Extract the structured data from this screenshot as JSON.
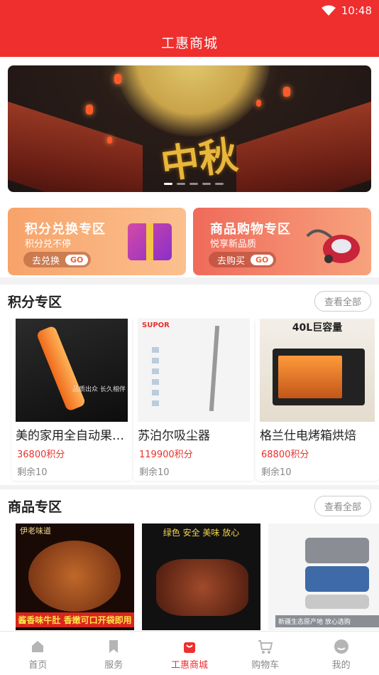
{
  "status_bar": {
    "time": "10:48"
  },
  "header": {
    "title": "工惠商城"
  },
  "promos": [
    {
      "title": "积分兑换专区",
      "subtitle": "积分兑不停",
      "button": "去兑换",
      "go": "GO"
    },
    {
      "title": "商品购物专区",
      "subtitle": "悦享新品质",
      "button": "去购买",
      "go": "GO"
    }
  ],
  "banner": {
    "text": "中秋"
  },
  "points_section": {
    "title": "积分专区",
    "more": "查看全部",
    "items": [
      {
        "name": "美的家用全自动果汁机",
        "price": "36800积分",
        "stock": "剩余10",
        "image_text": "品质出众 长久相伴"
      },
      {
        "name": "苏泊尔吸尘器",
        "price": "119900积分",
        "stock": "剩余10",
        "image_text": "SUPOR"
      },
      {
        "name": "格兰仕电烤箱烘焙",
        "price": "68800积分",
        "stock": "剩余10",
        "image_text": "40L巨容量"
      }
    ]
  },
  "goods_section": {
    "title": "商品专区",
    "more": "查看全部",
    "items": [
      {
        "badge": "伊老味道",
        "caption": "酱香味牛肚 香嫩可口开袋即用"
      },
      {
        "caption": "绿色 安全 美味 放心"
      },
      {
        "caption": "新疆生态原产地 放心选购"
      }
    ]
  },
  "tabs": [
    {
      "label": "首页",
      "icon": "home-icon",
      "active": false
    },
    {
      "label": "服务",
      "icon": "bookmark-icon",
      "active": false
    },
    {
      "label": "工惠商城",
      "icon": "shopping-bag-icon",
      "active": true
    },
    {
      "label": "购物车",
      "icon": "cart-icon",
      "active": false
    },
    {
      "label": "我的",
      "icon": "profile-icon",
      "active": false
    }
  ],
  "colors": {
    "brand": "#ef2e2e",
    "price": "#e8312b"
  }
}
